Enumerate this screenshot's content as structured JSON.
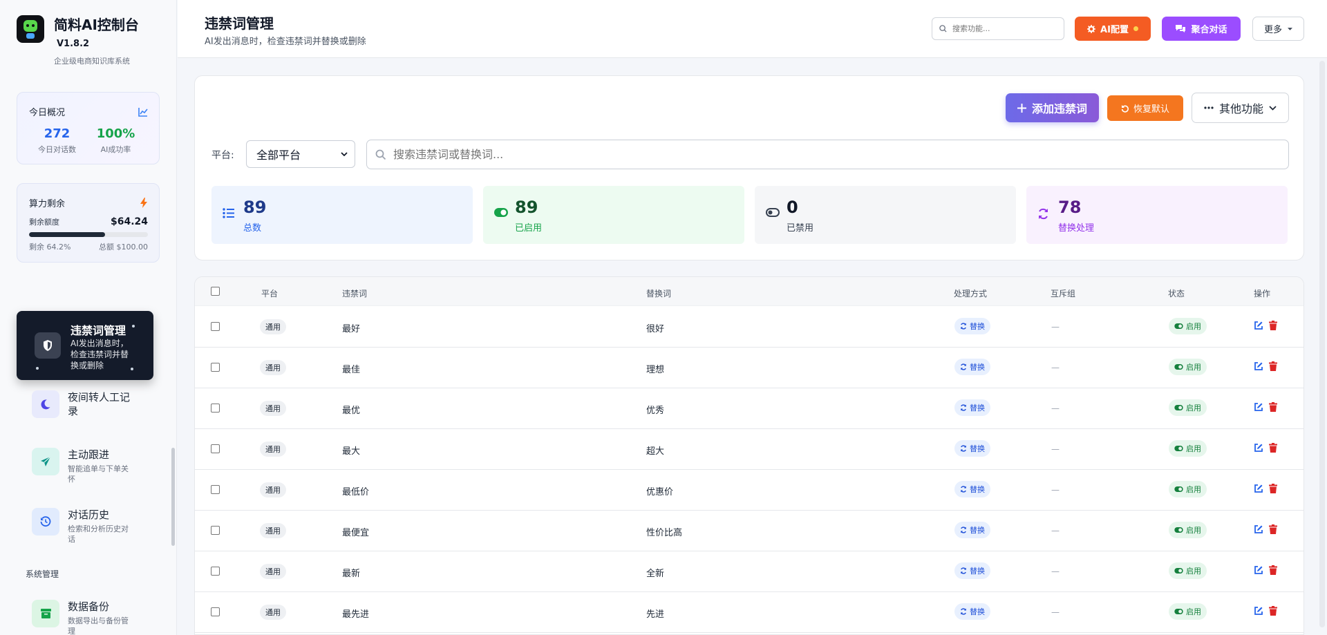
{
  "brand": {
    "title": "简料AI控制台",
    "version": "V1.8.2",
    "subtitle": "企业级电商知识库系统"
  },
  "today": {
    "title": "今日概况",
    "icon": "chart-line-icon",
    "stats": [
      {
        "value": "272",
        "label": "今日对话数",
        "color": "#2563eb"
      },
      {
        "value": "100%",
        "label": "AI成功率",
        "color": "#16a34a"
      }
    ]
  },
  "power": {
    "title": "算力剩余",
    "icon": "bolt-icon",
    "balance_label": "剩余额度",
    "balance": "$64.24",
    "progress": 0.642,
    "remaining": "剩余 64.2%",
    "total": "总额 $100.00"
  },
  "nav": {
    "active": {
      "title": "违禁词管理",
      "desc": "AI发出消息时，检查违禁词并替换或删除",
      "icon": "shield-icon"
    },
    "items": [
      {
        "title": "夜间转人工记录",
        "desc": "",
        "icon": "moon-icon",
        "color": "#4f46e5",
        "bg": "#e8eafc"
      },
      {
        "title": "主动跟进",
        "desc": "智能追单与下单关怀",
        "icon": "paper-plane-icon",
        "color": "#0d9488",
        "bg": "#d9f4ef"
      },
      {
        "title": "对话历史",
        "desc": "检索和分析历史对话",
        "icon": "history-icon",
        "color": "#2563eb",
        "bg": "#e1ebfd"
      }
    ],
    "section_label": "系统管理",
    "bottom_item": {
      "title": "数据备份",
      "desc": "数据导出与备份管理",
      "icon": "archive-icon",
      "color": "#16a34a",
      "bg": "#dcf5e4"
    }
  },
  "header": {
    "title": "违禁词管理",
    "subtitle": "AI发出消息时，检查违禁词并替换或删除",
    "search_placeholder": "搜索功能...",
    "ai_button": "AI配置",
    "merge_button": "聚合对话",
    "more_button": "更多"
  },
  "toolbar": {
    "add_button": "添加违禁词",
    "restore_button": "恢复默认",
    "other_button": "其他功能"
  },
  "filter": {
    "platform_label": "平台:",
    "platform_value": "全部平台",
    "search_placeholder": "搜索违禁词或替换词..."
  },
  "stats": [
    {
      "value": "89",
      "label": "总数",
      "icon": "list-icon",
      "color": "#1e3a8a",
      "label_color": "#2563eb",
      "bg": "#eef4fe"
    },
    {
      "value": "89",
      "label": "已启用",
      "icon": "toggle-on-icon",
      "color": "#14532d",
      "label_color": "#16a34a",
      "bg": "#edfbf1"
    },
    {
      "value": "0",
      "label": "已禁用",
      "icon": "toggle-off-icon",
      "color": "#111827",
      "label_color": "#374151",
      "bg": "#f5f6f8"
    },
    {
      "value": "78",
      "label": "替换处理",
      "icon": "sync-icon",
      "color": "#581c87",
      "label_color": "#9333ea",
      "bg": "#f9f1fe"
    }
  ],
  "table": {
    "columns": [
      "平台",
      "违禁词",
      "替换词",
      "处理方式",
      "互斥组",
      "状态",
      "操作"
    ],
    "rows": [
      {
        "platform": "通用",
        "word": "最好",
        "replace": "很好",
        "action": "替换",
        "group": "—",
        "status": "启用"
      },
      {
        "platform": "通用",
        "word": "最佳",
        "replace": "理想",
        "action": "替换",
        "group": "—",
        "status": "启用"
      },
      {
        "platform": "通用",
        "word": "最优",
        "replace": "优秀",
        "action": "替换",
        "group": "—",
        "status": "启用"
      },
      {
        "platform": "通用",
        "word": "最大",
        "replace": "超大",
        "action": "替换",
        "group": "—",
        "status": "启用"
      },
      {
        "platform": "通用",
        "word": "最低价",
        "replace": "优惠价",
        "action": "替换",
        "group": "—",
        "status": "启用"
      },
      {
        "platform": "通用",
        "word": "最便宜",
        "replace": "性价比高",
        "action": "替换",
        "group": "—",
        "status": "启用"
      },
      {
        "platform": "通用",
        "word": "最新",
        "replace": "全新",
        "action": "替换",
        "group": "—",
        "status": "启用"
      },
      {
        "platform": "通用",
        "word": "最先进",
        "replace": "先进",
        "action": "替换",
        "group": "—",
        "status": "启用"
      }
    ]
  },
  "colors": {
    "accent": "#6d6ae8",
    "orange": "#f45c23",
    "purple": "#9b4dff",
    "edit": "#2563eb",
    "delete": "#dc2626"
  }
}
